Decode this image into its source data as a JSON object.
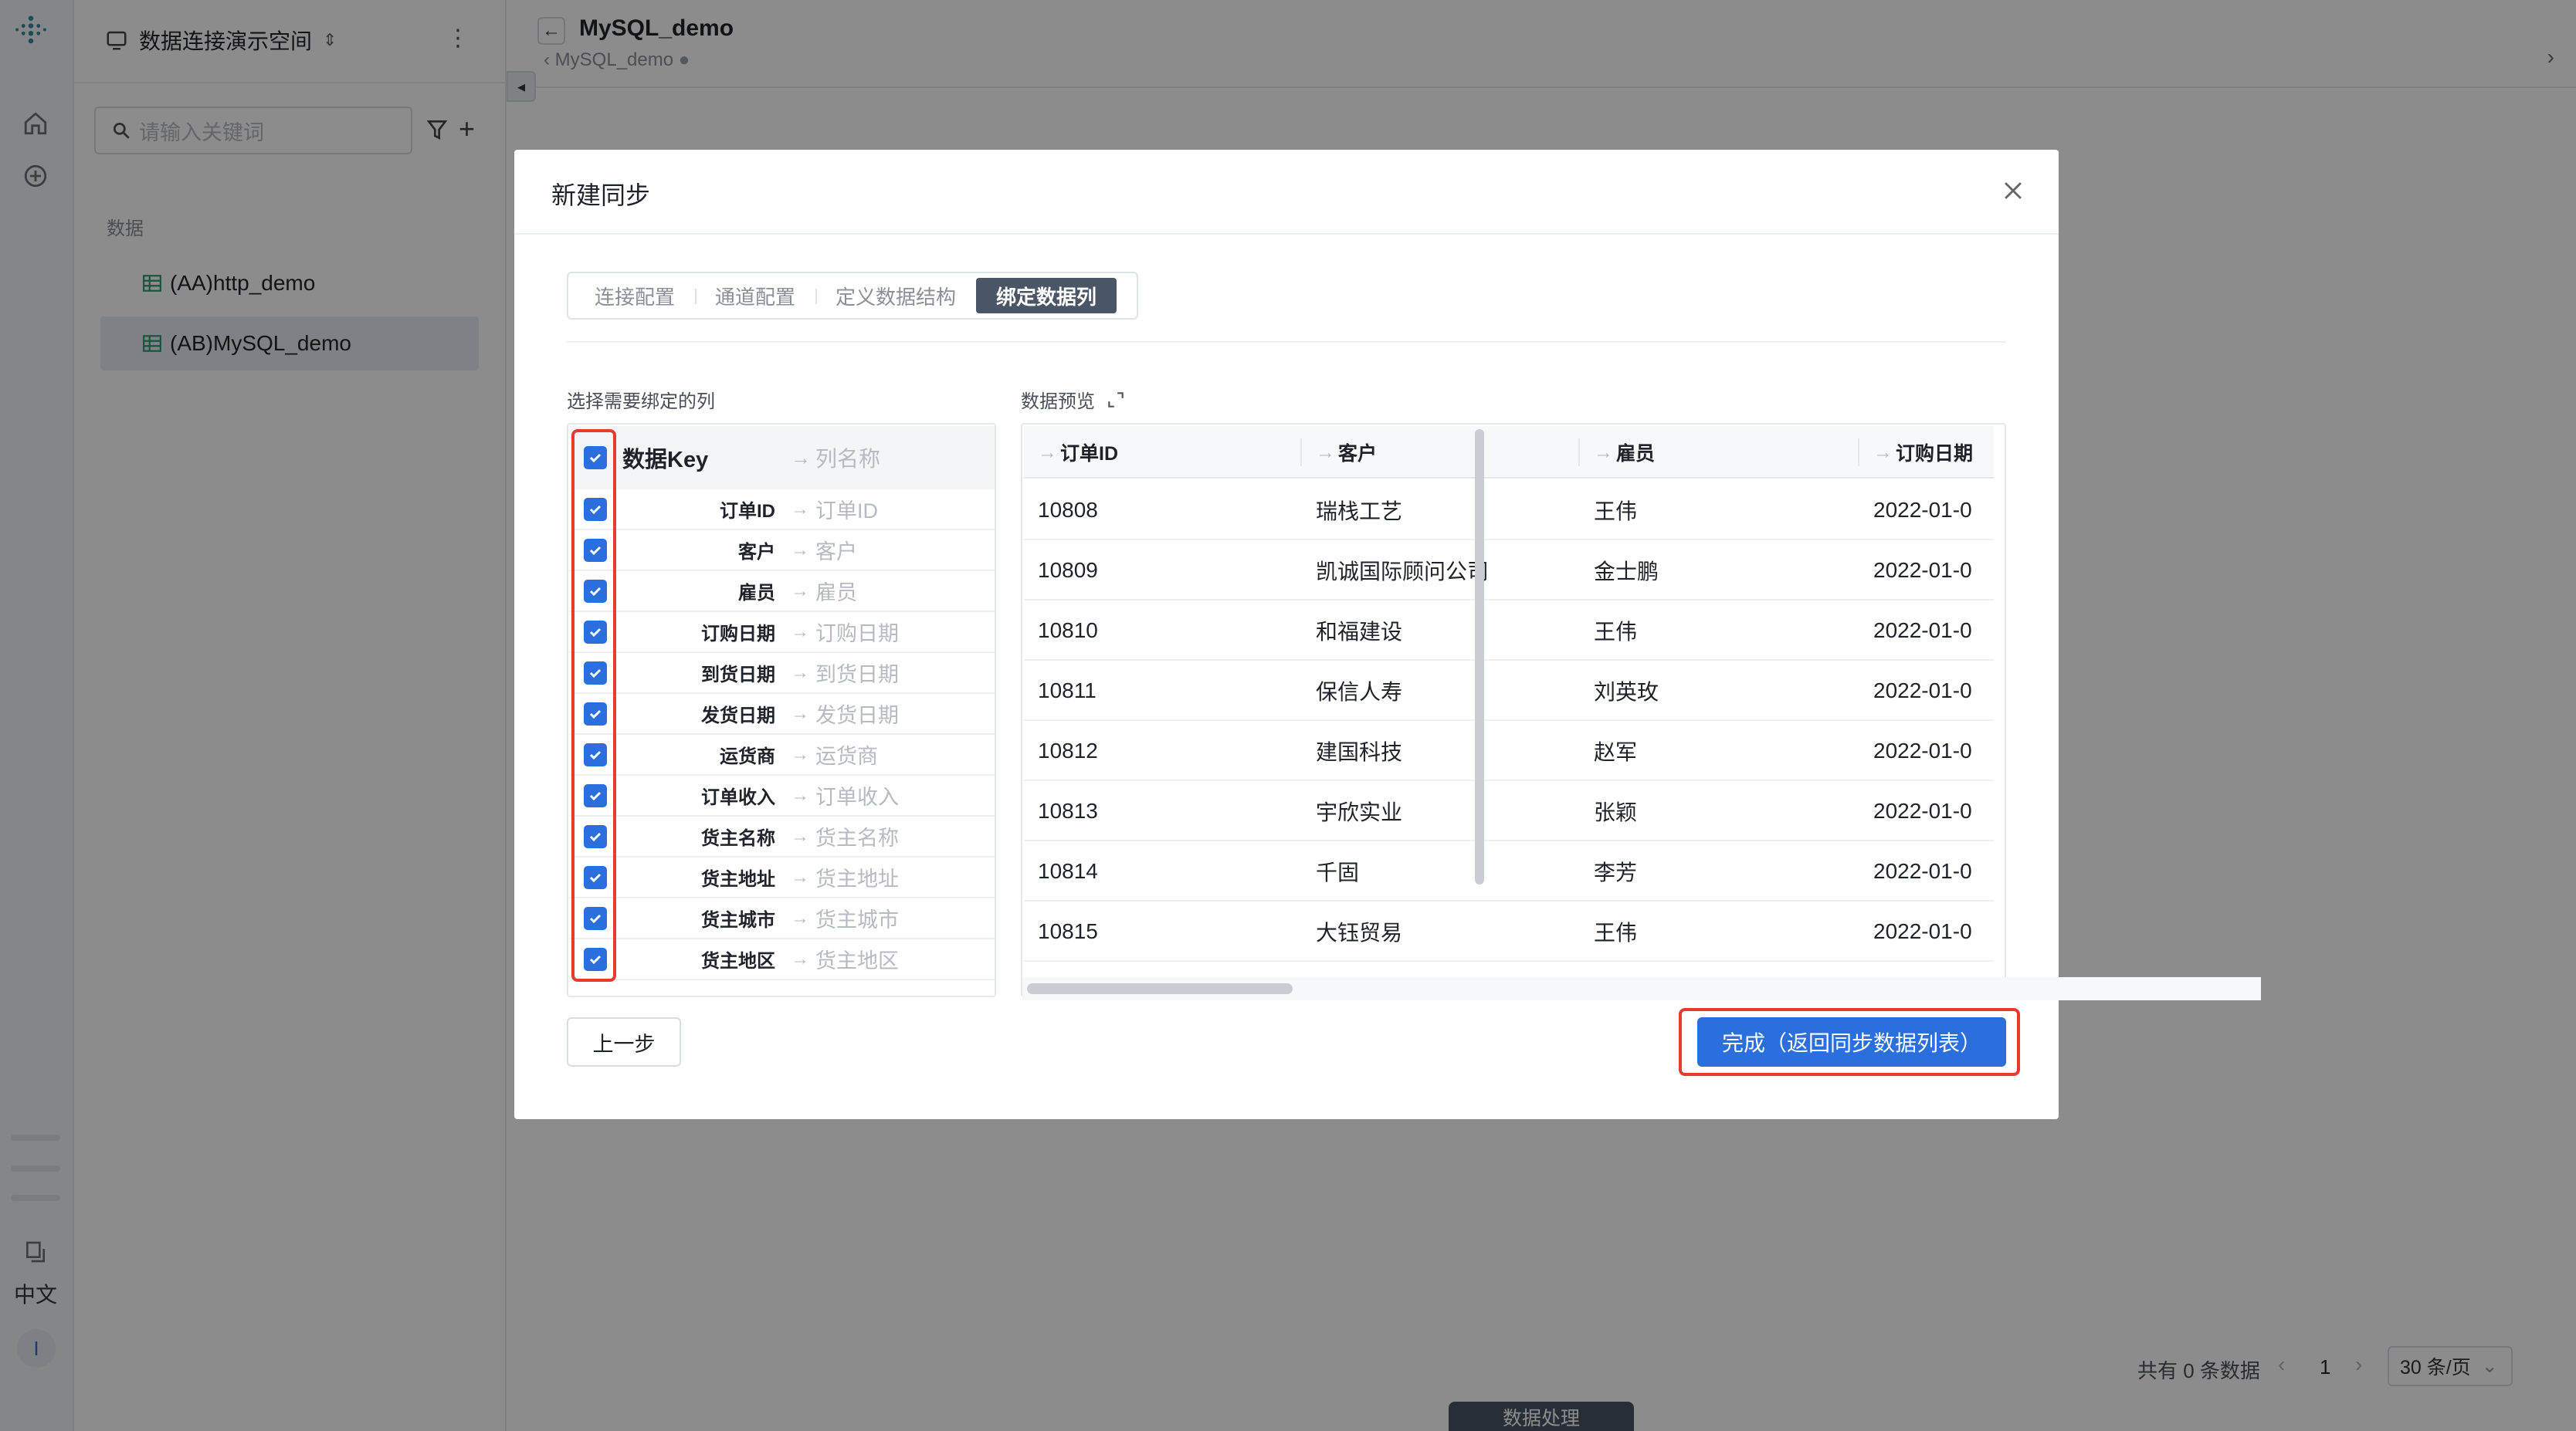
{
  "workspace": {
    "name": "数据连接演示空间"
  },
  "sidebar": {
    "search_placeholder": "请输入关键词",
    "section_label": "数据",
    "items": [
      {
        "label": "(AA)http_demo"
      },
      {
        "label": "(AB)MySQL_demo"
      }
    ]
  },
  "rail": {
    "language": "中文",
    "avatar": "I"
  },
  "header": {
    "title": "MySQL_demo",
    "breadcrumb": "MySQL_demo"
  },
  "footer": {
    "count_text": "共有 0 条数据",
    "page": "1",
    "page_size": "30 条/页",
    "bottom_tab": "数据处理"
  },
  "modal": {
    "title": "新建同步",
    "steps": [
      "连接配置",
      "通道配置",
      "定义数据结构",
      "绑定数据列"
    ],
    "active_step": 3,
    "left_label": "选择需要绑定的列",
    "right_label": "数据预览",
    "columns_header": {
      "key": "数据Key",
      "name": "列名称"
    },
    "columns": [
      {
        "key": "订单ID",
        "name": "订单ID"
      },
      {
        "key": "客户",
        "name": "客户"
      },
      {
        "key": "雇员",
        "name": "雇员"
      },
      {
        "key": "订购日期",
        "name": "订购日期"
      },
      {
        "key": "到货日期",
        "name": "到货日期"
      },
      {
        "key": "发货日期",
        "name": "发货日期"
      },
      {
        "key": "运货商",
        "name": "运货商"
      },
      {
        "key": "订单收入",
        "name": "订单收入"
      },
      {
        "key": "货主名称",
        "name": "货主名称"
      },
      {
        "key": "货主地址",
        "name": "货主地址"
      },
      {
        "key": "货主城市",
        "name": "货主城市"
      },
      {
        "key": "货主地区",
        "name": "货主地区"
      }
    ],
    "preview": {
      "headers": [
        "订单ID",
        "客户",
        "雇员",
        "订购日期"
      ],
      "rows": [
        [
          "10808",
          "瑞栈工艺",
          "王伟",
          "2022-01-0"
        ],
        [
          "10809",
          "凯诚国际顾问公司",
          "金士鹏",
          "2022-01-0"
        ],
        [
          "10810",
          "和福建设",
          "王伟",
          "2022-01-0"
        ],
        [
          "10811",
          "保信人寿",
          "刘英玫",
          "2022-01-0"
        ],
        [
          "10812",
          "建国科技",
          "赵军",
          "2022-01-0"
        ],
        [
          "10813",
          "宇欣实业",
          "张颖",
          "2022-01-0"
        ],
        [
          "10814",
          "千固",
          "李芳",
          "2022-01-0"
        ],
        [
          "10815",
          "大钰贸易",
          "王伟",
          "2022-01-0"
        ]
      ]
    },
    "prev_button": "上一步",
    "done_button": "完成（返回同步数据列表）"
  },
  "colors": {
    "primary": "#2b6fde",
    "highlight": "#e63b2e",
    "active_step": "#4a5566"
  }
}
